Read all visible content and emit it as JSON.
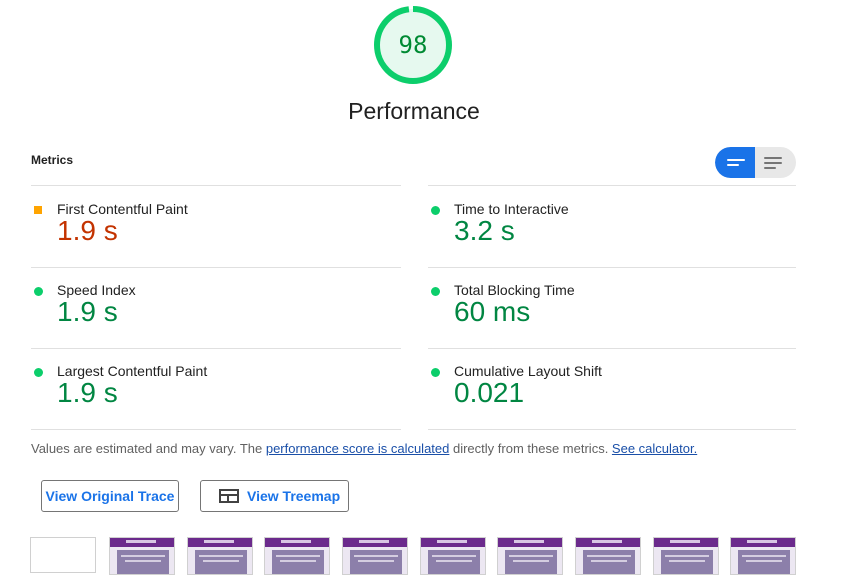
{
  "gauge": {
    "score": "98",
    "fraction": 0.98,
    "title": "Performance",
    "color": "#0cce6b"
  },
  "metrics": {
    "title": "Metrics",
    "items": [
      {
        "label": "First Contentful Paint",
        "value": "1.9 s",
        "status": "average"
      },
      {
        "label": "Time to Interactive",
        "value": "3.2 s",
        "status": "pass"
      },
      {
        "label": "Speed Index",
        "value": "1.9 s",
        "status": "pass"
      },
      {
        "label": "Total Blocking Time",
        "value": "60 ms",
        "status": "pass"
      },
      {
        "label": "Largest Contentful Paint",
        "value": "1.9 s",
        "status": "pass"
      },
      {
        "label": "Cumulative Layout Shift",
        "value": "0.021",
        "status": "pass"
      }
    ]
  },
  "toggle": {
    "selected": "compact",
    "icons": [
      "summary-view-icon",
      "detailed-view-icon"
    ]
  },
  "footnote": {
    "prefix": "Values are estimated and may vary. The ",
    "link1": "performance score is calculated",
    "middle": " directly from these metrics. ",
    "link2": "See calculator."
  },
  "buttons": {
    "trace": "View Original Trace",
    "treemap": "View Treemap"
  },
  "colors": {
    "pass": "#0cce6b",
    "average": "#ffa400",
    "accent": "#1a73e8"
  }
}
